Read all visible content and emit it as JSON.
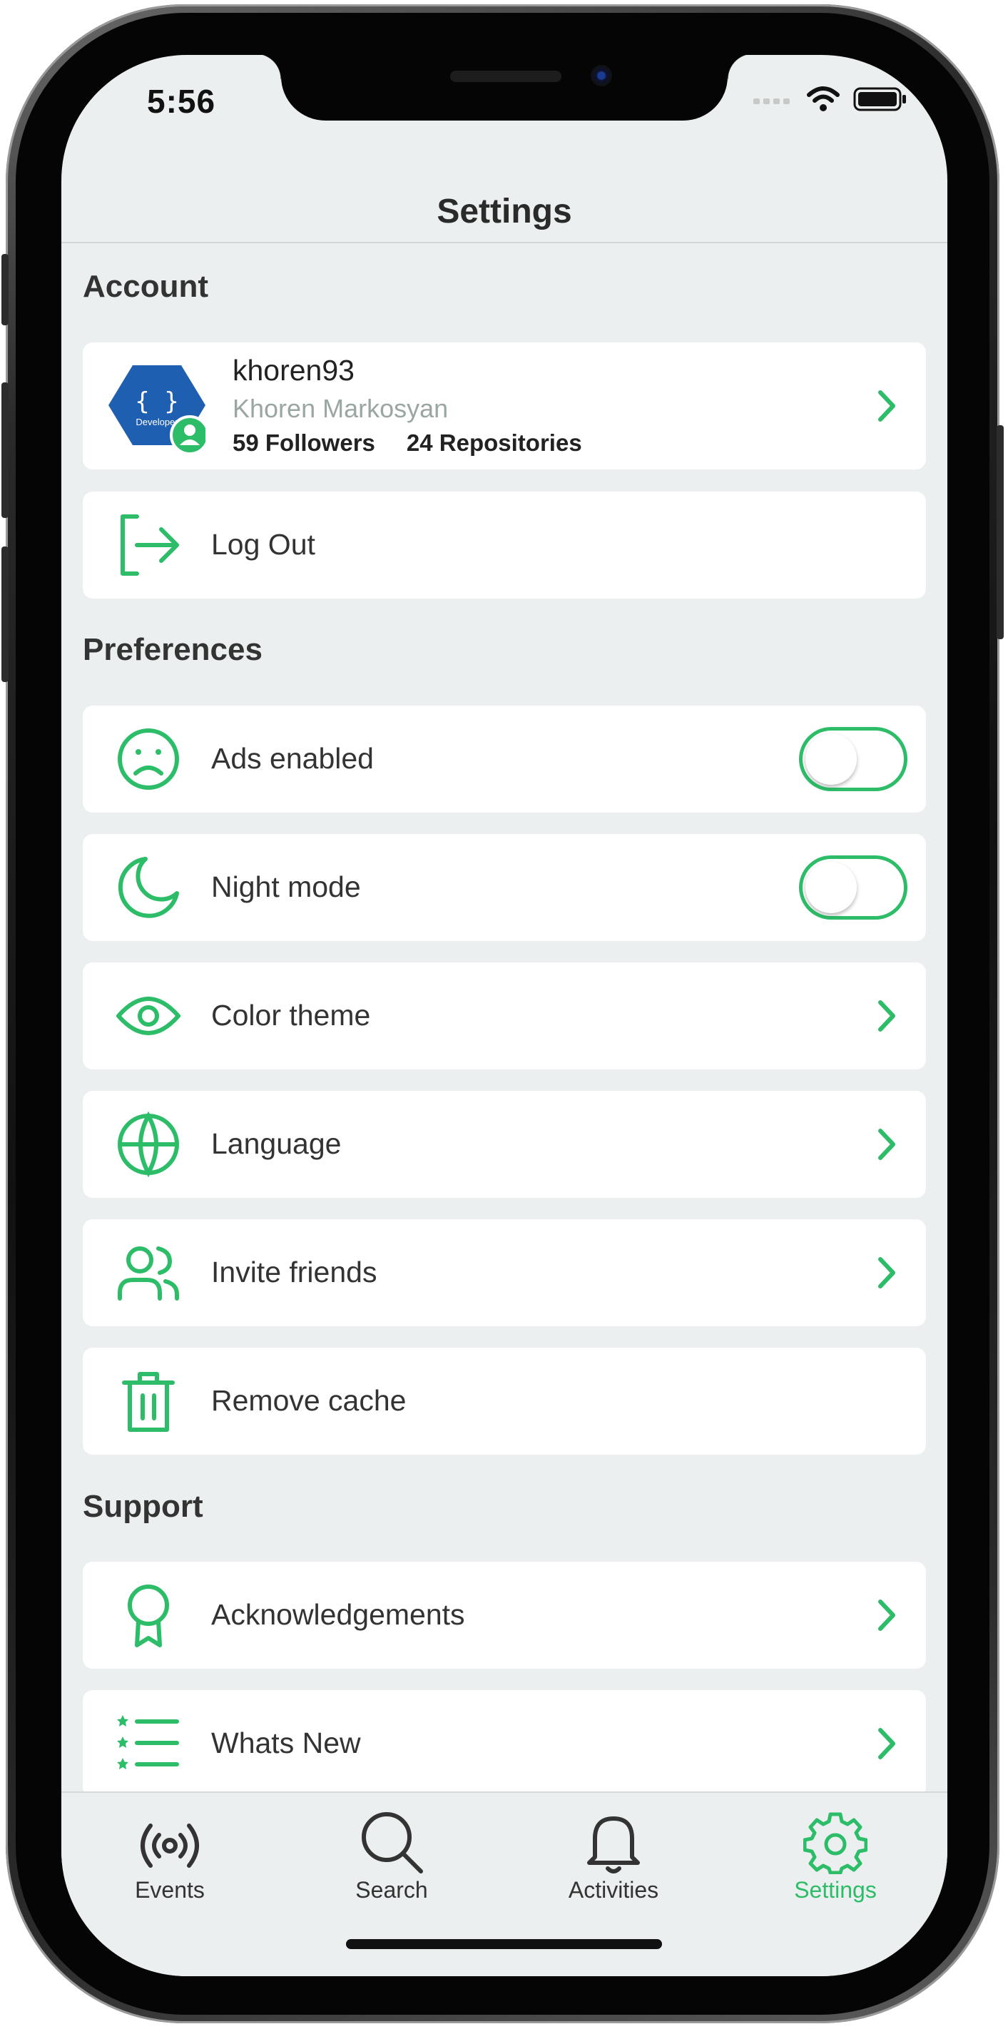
{
  "status_bar": {
    "time": "5:56"
  },
  "nav": {
    "title": "Settings"
  },
  "account": {
    "section_title": "Account",
    "avatar_text": "{ }",
    "avatar_caption": "Developer",
    "username": "khoren93",
    "full_name": "Khoren Markosyan",
    "followers": "59 Followers",
    "repositories": "24 Repositories",
    "logout_label": "Log Out"
  },
  "preferences": {
    "section_title": "Preferences",
    "ads_label": "Ads enabled",
    "ads_enabled": false,
    "night_label": "Night mode",
    "night_enabled": false,
    "color_theme_label": "Color theme",
    "language_label": "Language",
    "invite_label": "Invite friends",
    "remove_cache_label": "Remove cache"
  },
  "support": {
    "section_title": "Support",
    "acknowledgements_label": "Acknowledgements",
    "whats_new_label": "Whats New"
  },
  "tabbar": {
    "events": "Events",
    "search": "Search",
    "activities": "Activities",
    "settings": "Settings",
    "active": "Settings"
  },
  "colors": {
    "accent": "#2dbd69",
    "background": "#eceff0",
    "card": "#ffffff",
    "avatar_blue": "#1f5fb2"
  }
}
